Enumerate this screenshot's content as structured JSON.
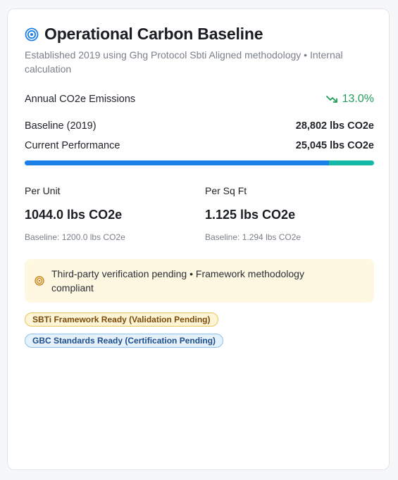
{
  "card": {
    "title": "Operational Carbon Baseline",
    "subtitle": "Established 2019 using Ghg Protocol Sbti Aligned methodology • Internal calculation"
  },
  "emissions": {
    "label": "Annual CO2e Emissions",
    "trend": "13.0%",
    "trend_direction": "down",
    "trend_color": "#1e9e58"
  },
  "baseline": {
    "label": "Baseline (2019)",
    "value": "28,802 lbs CO2e"
  },
  "current": {
    "label": "Current Performance",
    "value": "25,045 lbs CO2e",
    "progress_fraction": 0.87,
    "bar_fill_color": "#1a7fe6",
    "bar_remainder_color": "#14b8a6"
  },
  "per_unit": {
    "label": "Per Unit",
    "value": "1044.0 lbs CO2e",
    "baseline": "Baseline: 1200.0 lbs CO2e"
  },
  "per_sqft": {
    "label": "Per Sq Ft",
    "value": "1.125 lbs CO2e",
    "baseline": "Baseline: 1.294 lbs CO2e"
  },
  "notice": {
    "text": "Third-party verification pending • Framework methodology compliant",
    "icon": "target-icon"
  },
  "badges": {
    "sbti": "SBTi Framework Ready (Validation Pending)",
    "gbc": "GBC Standards Ready (Certification Pending)"
  },
  "colors": {
    "accent": "#1a7fe6",
    "notice_bg": "#fef7e2"
  }
}
